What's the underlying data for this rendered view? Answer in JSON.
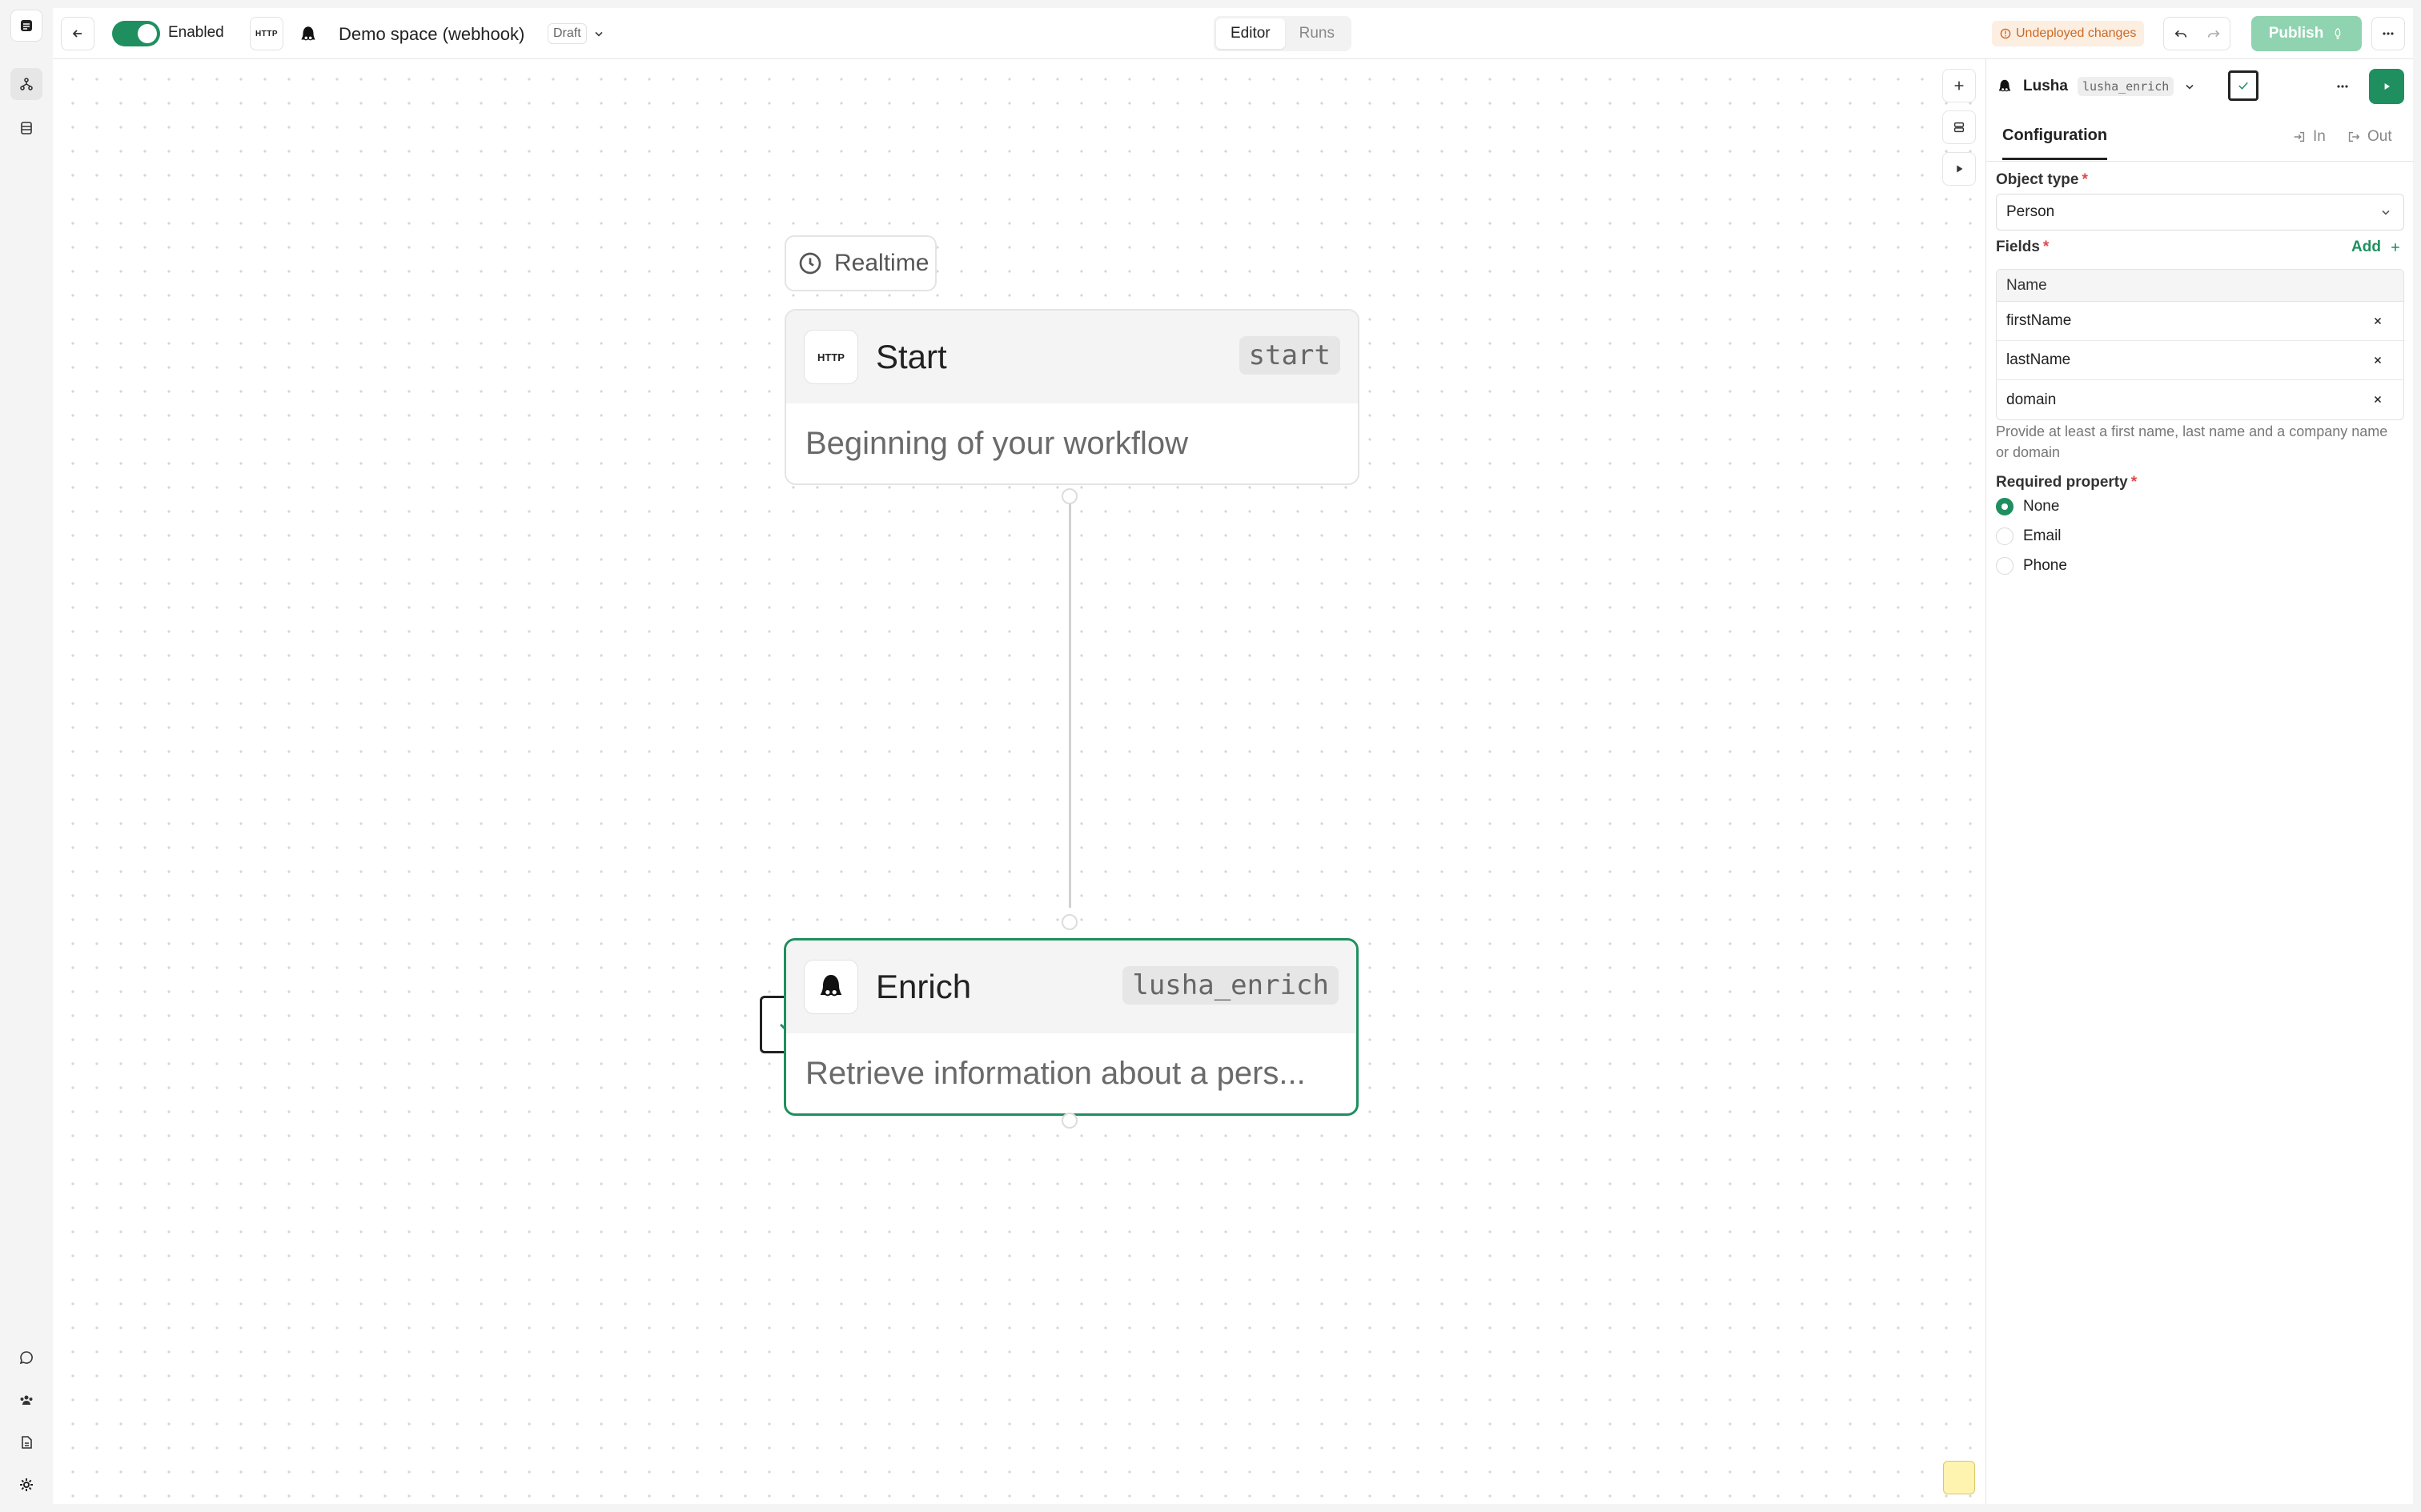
{
  "topbar": {
    "enabled_label": "Enabled",
    "http_badge": "HTTP",
    "workflow_title": "Demo space (webhook)",
    "status_badge": "Draft",
    "tabs": [
      {
        "label": "Editor"
      },
      {
        "label": "Runs"
      }
    ],
    "undeployed_label": "Undeployed changes",
    "publish_label": "Publish"
  },
  "canvas": {
    "trigger_label": "Realtime",
    "nodes": [
      {
        "title": "Start",
        "key": "start",
        "description": "Beginning of your workflow",
        "icon_text": "HTTP"
      },
      {
        "title": "Enrich",
        "key": "lusha_enrich",
        "description": "Retrieve information about a pers..."
      }
    ]
  },
  "panel": {
    "integration_name": "Lusha",
    "integration_key": "lusha_enrich",
    "tabs": {
      "configuration": "Configuration",
      "in": "In",
      "out": "Out"
    },
    "object_type_label": "Object type",
    "object_type_value": "Person",
    "fields_label": "Fields",
    "add_label": "Add",
    "fields_header": "Name",
    "fields": [
      "firstName",
      "lastName",
      "domain"
    ],
    "hint": "Provide at least a first name, last name and a company name or domain",
    "required_property_label": "Required property",
    "required_options": [
      "None",
      "Email",
      "Phone"
    ],
    "required_selected": "None"
  },
  "colors": {
    "accent": "#1f8f5f",
    "warning": "#c96a24",
    "publish_disabled": "#8fd3b0"
  }
}
